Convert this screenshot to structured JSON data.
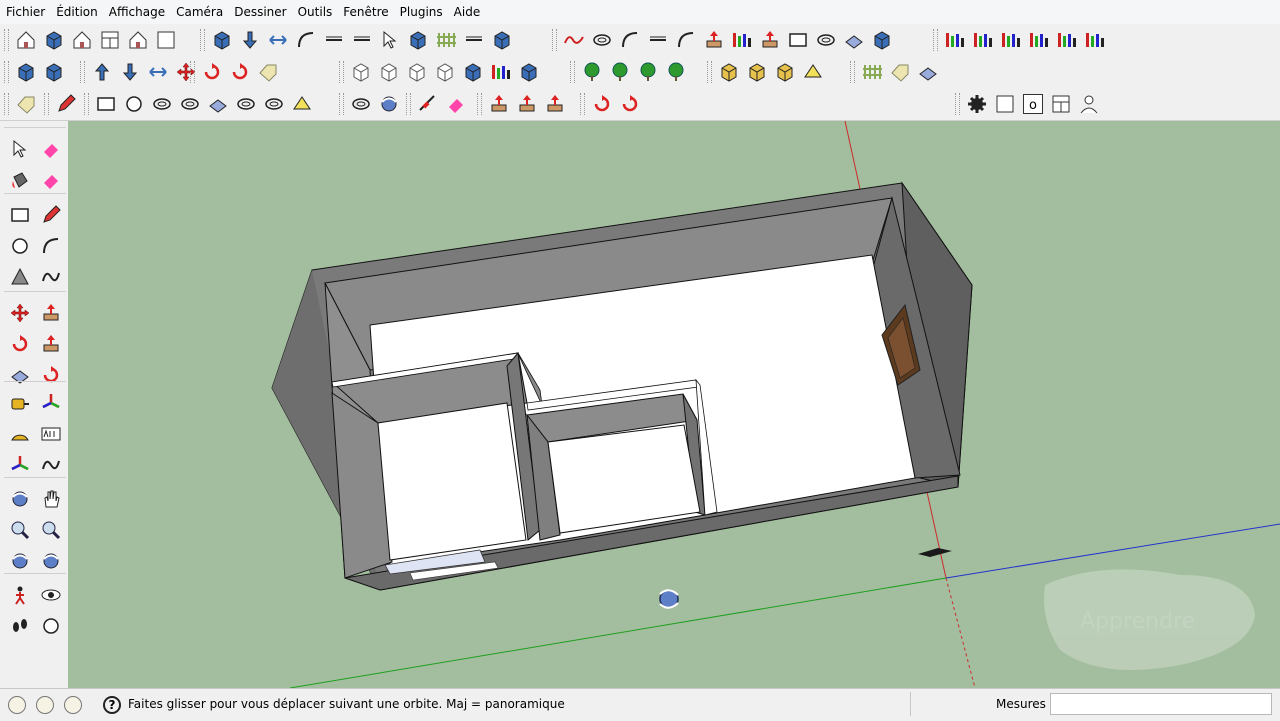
{
  "menu": [
    "Fichier",
    "Édition",
    "Affichage",
    "Caméra",
    "Dessiner",
    "Outils",
    "Fenêtre",
    "Plugins",
    "Aide"
  ],
  "toolbar3_extra": {
    "circle_small_glyph": "o"
  },
  "left_toolbar_labels": {
    "text_tool_glyph": "ABC",
    "section_glyph": "CS"
  },
  "watermark": "Apprendre",
  "status": {
    "help_icon": "?",
    "message": "Faites glisser pour vous déplacer suivant une orbite.  Maj = panoramique",
    "measure_label": "Mesures",
    "measure_value": ""
  },
  "colors": {
    "viewport_bg": "#a3be9e",
    "wall_face": "#7d7d7d",
    "floor": "#ffffff",
    "axis_red": "#cc2b2b",
    "axis_green": "#1f9e1f",
    "axis_blue": "#2233cc"
  }
}
